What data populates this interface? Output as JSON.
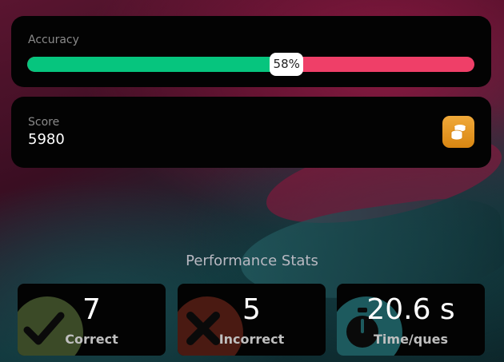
{
  "accuracy": {
    "label": "Accuracy",
    "percent": 58,
    "percent_text": "58%",
    "correct_color": "#06c57e",
    "incorrect_color": "#ef3f68"
  },
  "score": {
    "label": "Score",
    "value": "5980",
    "icon": "coins-icon",
    "icon_color": "#e0961f"
  },
  "performance": {
    "title": "Performance Stats",
    "stats": [
      {
        "value": "7",
        "label": "Correct",
        "icon": "check-icon"
      },
      {
        "value": "5",
        "label": "Incorrect",
        "icon": "cross-icon"
      },
      {
        "value": "20.6 s",
        "label": "Time/ques",
        "icon": "timer-icon"
      }
    ]
  }
}
